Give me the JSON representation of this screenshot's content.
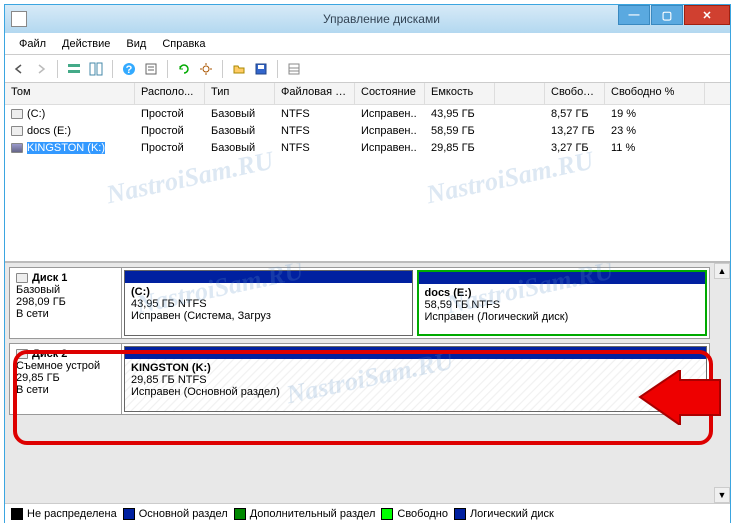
{
  "title": "Управление дисками",
  "menu": {
    "file": "Файл",
    "action": "Действие",
    "view": "Вид",
    "help": "Справка"
  },
  "columns": {
    "volume": "Том",
    "layout": "Располо...",
    "type": "Тип",
    "fs": "Файловая с...",
    "status": "Состояние",
    "capacity": "Емкость",
    "free": "Свобод...",
    "freepct": "Свободно %"
  },
  "volumes": [
    {
      "name": "(C:)",
      "layout": "Простой",
      "type": "Базовый",
      "fs": "NTFS",
      "status": "Исправен..",
      "capacity": "43,95 ГБ",
      "free": "8,57 ГБ",
      "freepct": "19 %",
      "removable": false,
      "selected": false
    },
    {
      "name": "docs (E:)",
      "layout": "Простой",
      "type": "Базовый",
      "fs": "NTFS",
      "status": "Исправен..",
      "capacity": "58,59 ГБ",
      "free": "13,27 ГБ",
      "freepct": "23 %",
      "removable": false,
      "selected": false
    },
    {
      "name": "KINGSTON (K:)",
      "layout": "Простой",
      "type": "Базовый",
      "fs": "NTFS",
      "status": "Исправен..",
      "capacity": "29,85 ГБ",
      "free": "3,27 ГБ",
      "freepct": "11 %",
      "removable": true,
      "selected": true
    }
  ],
  "disks": [
    {
      "name": "Диск 1",
      "type": "Базовый",
      "size": "298,09 ГБ",
      "status": "В сети",
      "parts": [
        {
          "name": "(C:)",
          "info": "43,95 ГБ NTFS",
          "status": "Исправен (Система, Загруз",
          "class": "primary"
        },
        {
          "name": "docs  (E:)",
          "info": "58,59 ГБ NTFS",
          "status": "Исправен (Логический диск)",
          "class": "logical"
        }
      ]
    },
    {
      "name": "Диск 2",
      "type": "Съемное устрой",
      "size": "29,85 ГБ",
      "status": "В сети",
      "parts": [
        {
          "name": "KINGSTON  (K:)",
          "info": "29,85 ГБ NTFS",
          "status": "Исправен (Основной раздел)",
          "class": "primary hatched"
        }
      ]
    }
  ],
  "legend": {
    "unalloc": "Не распределена",
    "primary": "Основной раздел",
    "extended": "Дополнительный раздел",
    "free": "Свободно",
    "logical": "Логический диск"
  },
  "watermark": "NastroiSam.RU"
}
